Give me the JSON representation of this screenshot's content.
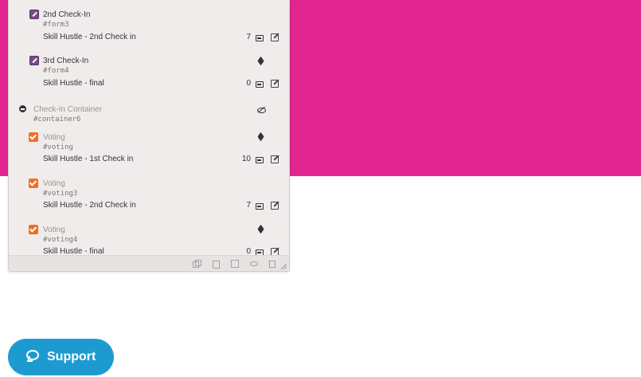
{
  "colors": {
    "pink_background": "#e1268f",
    "support_button": "#1d9bd1",
    "form_icon": "#7a4a86",
    "voting_icon": "#f26f21"
  },
  "items": [
    {
      "icon": "form-icon",
      "title": "2nd Check-In",
      "id": "#form3",
      "subtitle": "Skill Hustle - 2nd Check in",
      "count": "7"
    },
    {
      "icon": "form-icon",
      "title": "3rd Check-In",
      "id": "#form4",
      "subtitle": "Skill Hustle - final",
      "count": "0"
    },
    {
      "icon": "remove-circle-icon",
      "title": "Check-In Container",
      "id": "#container6"
    },
    {
      "icon": "voting-checkbox-icon",
      "title": "Voting",
      "id": "#voting",
      "subtitle": "Skill Hustle - 1st Check in",
      "count": "10"
    },
    {
      "icon": "voting-checkbox-icon",
      "title": "Voting",
      "id": "#voting3",
      "subtitle": "Skill Hustle - 2nd Check in",
      "count": "7"
    },
    {
      "icon": "voting-checkbox-icon",
      "title": "Voting",
      "id": "#voting4",
      "subtitle": "Skill Hustle - final",
      "count": "0"
    }
  ],
  "footer_icons": [
    "copy-icon",
    "paste-icon",
    "select-icon",
    "hide-icon",
    "trash-icon"
  ],
  "support": {
    "label": "Support",
    "icon": "chat-bubble-icon"
  }
}
